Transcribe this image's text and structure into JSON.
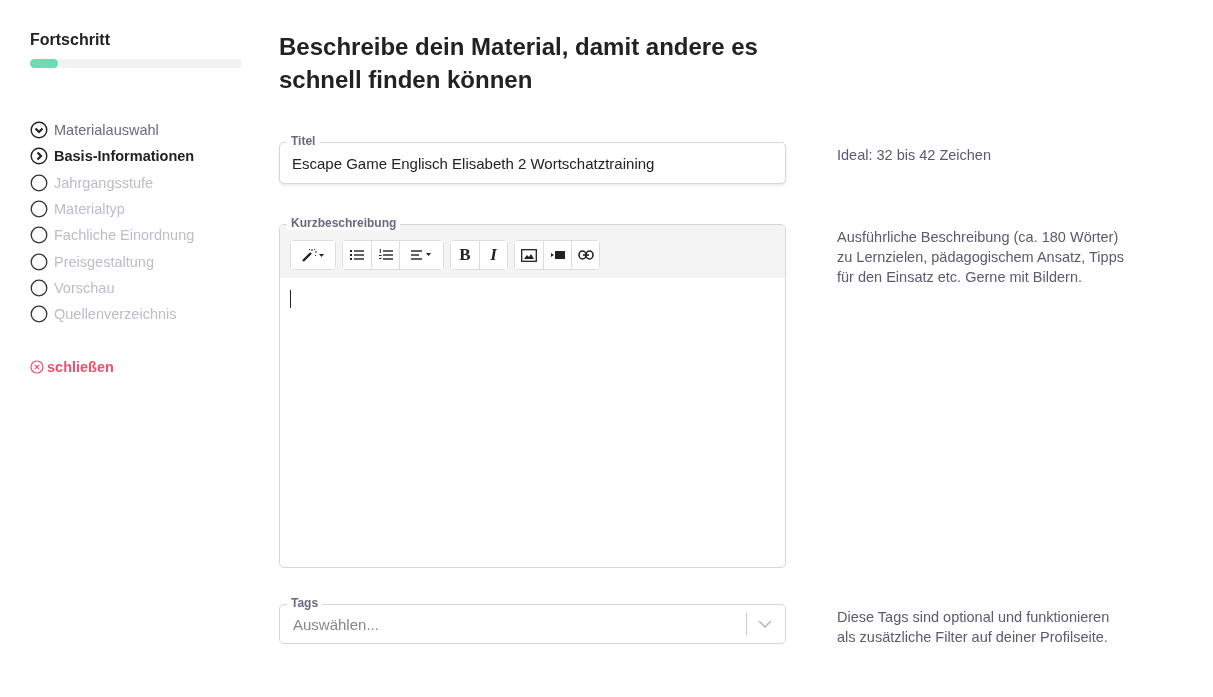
{
  "sidebar": {
    "title": "Fortschritt",
    "progress": {
      "level": 0.13
    },
    "steps": [
      {
        "label": "Materialauswahl",
        "kind": "done"
      },
      {
        "label": "Basis-Informationen",
        "kind": "current"
      },
      {
        "label": "Jahrgangsstufe",
        "kind": "todo"
      },
      {
        "label": "Materialtyp",
        "kind": "todo"
      },
      {
        "label": "Fachliche Einordnung",
        "kind": "todo"
      },
      {
        "label": "Preisgestaltung",
        "kind": "todo"
      },
      {
        "label": "Vorschau",
        "kind": "todo"
      },
      {
        "label": "Quellenverzeichnis",
        "kind": "todo"
      }
    ],
    "close_link": "schließen"
  },
  "heading": "Beschreibe dein Material, damit andere es schnell finden können",
  "title_field": {
    "label": "Titel",
    "value": "Escape Game Englisch Elisabeth 2 Wortschatztraining",
    "hint": "Ideal: 32 bis 42 Zeichen"
  },
  "description_field": {
    "label": "Kurzbeschreibung",
    "hint": "Ausführliche Beschreibung (ca. 180 Wörter) zu Lernzielen, pädagogischem Ansatz, Tipps für den Einsatz etc. Gerne mit Bildern.",
    "toolbar": [
      [
        {
          "kind": "style"
        }
      ],
      [
        {
          "kind": "bullets"
        },
        {
          "kind": "numbers"
        },
        {
          "kind": "align"
        }
      ],
      [
        {
          "kind": "bold",
          "text": "B"
        },
        {
          "kind": "italic",
          "text": "I"
        }
      ],
      [
        {
          "kind": "picture"
        },
        {
          "kind": "video"
        },
        {
          "kind": "link"
        }
      ]
    ]
  },
  "tags_field": {
    "label": "Tags",
    "placeholder": "Auswählen...",
    "hint": "Diese Tags sind optional und funktionieren als zusätzliche Filter auf deiner Profilseite."
  }
}
